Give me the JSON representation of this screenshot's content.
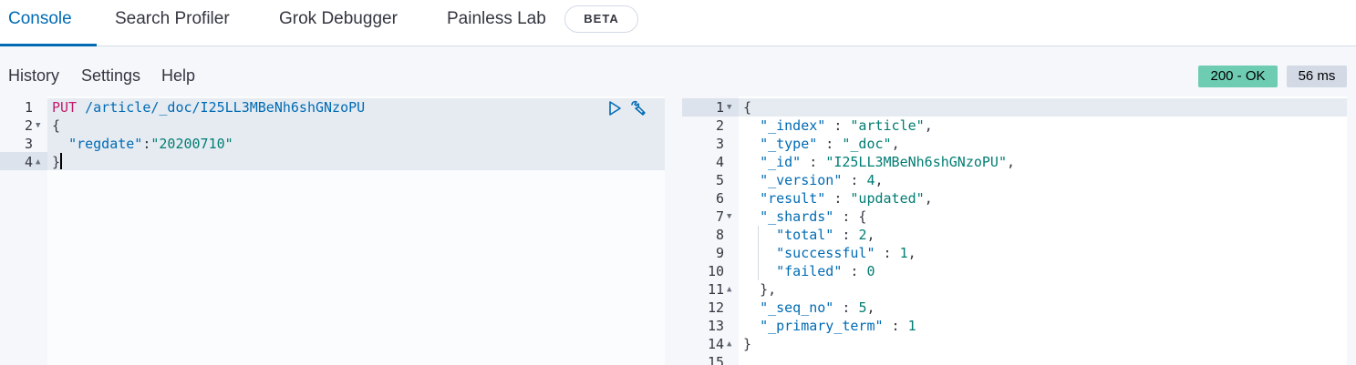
{
  "tabs": [
    {
      "label": "Console"
    },
    {
      "label": "Search Profiler"
    },
    {
      "label": "Grok Debugger"
    },
    {
      "label": "Painless Lab"
    }
  ],
  "beta_badge": "BETA",
  "toolbar": {
    "history": "History",
    "settings": "Settings",
    "help": "Help"
  },
  "status": {
    "code": "200 - OK",
    "timing": "56 ms"
  },
  "request": {
    "method": "PUT",
    "url": "/article/_doc/I25LL3MBeNh6shGNzoPU",
    "line_numbers": [
      "1",
      "2",
      "3",
      "4"
    ],
    "open_brace": "{",
    "body_key": "\"regdate\"",
    "body_colon": ":",
    "body_value": "\"20200710\"",
    "close_brace": "}"
  },
  "response": {
    "line_numbers": [
      "1",
      "2",
      "3",
      "4",
      "5",
      "6",
      "7",
      "8",
      "9",
      "10",
      "11",
      "12",
      "13",
      "14",
      "15"
    ],
    "open_brace": "{",
    "index_key": "\"_index\"",
    "index_value": "\"article\"",
    "type_key": "\"_type\"",
    "type_value": "\"_doc\"",
    "id_key": "\"_id\"",
    "id_value": "\"I25LL3MBeNh6shGNzoPU\"",
    "version_key": "\"_version\"",
    "version_value": "4",
    "result_key": "\"result\"",
    "result_value": "\"updated\"",
    "shards_key": "\"_shards\"",
    "total_key": "\"total\"",
    "total_value": "2",
    "successful_key": "\"successful\"",
    "successful_value": "1",
    "failed_key": "\"failed\"",
    "failed_value": "0",
    "shards_close": "},",
    "seq_no_key": "\"_seq_no\"",
    "seq_no_value": "5",
    "primary_term_key": "\"_primary_term\"",
    "primary_term_value": "1",
    "close_brace": "}"
  },
  "colors": {
    "accent": "#006bb4",
    "status_ok": "#6dccb1",
    "method": "#c21c6b",
    "string": "#017d73"
  },
  "icons": {
    "run": "play-icon",
    "settings": "wrench-icon"
  }
}
